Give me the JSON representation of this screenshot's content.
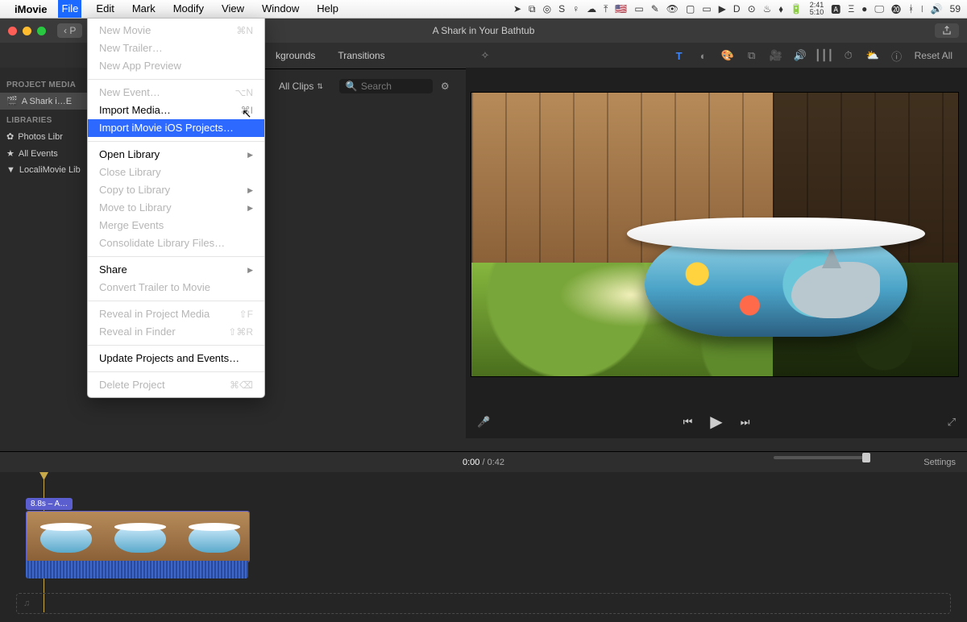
{
  "menubar": {
    "app_name": "iMovie",
    "items": [
      "File",
      "Edit",
      "Mark",
      "Modify",
      "View",
      "Window",
      "Help"
    ],
    "open_index": 0,
    "clock_time": "2:41",
    "clock_sub": "5:10",
    "right_extra": "59"
  },
  "titlebar": {
    "title": "A Shark in Your Bathtub",
    "back_glyph": "‹ P"
  },
  "toolbar2": {
    "left_tabs": [
      "kgrounds",
      "Transitions"
    ],
    "reset_all": "Reset All"
  },
  "filterbar": {
    "allclips": "All Clips",
    "search_placeholder": "Search"
  },
  "sidebar": {
    "section1": "PROJECT MEDIA",
    "project": "A Shark i…E",
    "section2": "LIBRARIES",
    "rows": [
      "Photos Libr",
      "All Events",
      "LocaliMovie Lib"
    ]
  },
  "dropdown": {
    "items": [
      {
        "label": "New Movie",
        "shortcut": "⌘N",
        "disabled": true
      },
      {
        "label": "New Trailer…",
        "shortcut": "",
        "disabled": true
      },
      {
        "label": "New App Preview",
        "shortcut": "",
        "disabled": true
      },
      {
        "sep": true
      },
      {
        "label": "New Event…",
        "shortcut": "⌥N",
        "disabled": true
      },
      {
        "label": "Import Media…",
        "shortcut": "⌘I",
        "disabled": false
      },
      {
        "label": "Import iMovie iOS Projects…",
        "shortcut": "",
        "disabled": false,
        "highlight": true
      },
      {
        "sep": true
      },
      {
        "label": "Open Library",
        "shortcut": "",
        "disabled": false,
        "submenu": true
      },
      {
        "label": "Close Library",
        "shortcut": "",
        "disabled": true
      },
      {
        "label": "Copy to Library",
        "shortcut": "",
        "disabled": true,
        "submenu": true
      },
      {
        "label": "Move to Library",
        "shortcut": "",
        "disabled": true,
        "submenu": true
      },
      {
        "label": "Merge Events",
        "shortcut": "",
        "disabled": true
      },
      {
        "label": "Consolidate Library Files…",
        "shortcut": "",
        "disabled": true
      },
      {
        "sep": true
      },
      {
        "label": "Share",
        "shortcut": "",
        "disabled": false,
        "submenu": true
      },
      {
        "label": "Convert Trailer to Movie",
        "shortcut": "",
        "disabled": true
      },
      {
        "sep": true
      },
      {
        "label": "Reveal in Project Media",
        "shortcut": "⇧F",
        "disabled": true
      },
      {
        "label": "Reveal in Finder",
        "shortcut": "⇧⌘R",
        "disabled": true
      },
      {
        "sep": true
      },
      {
        "label": "Update Projects and Events…",
        "shortcut": "",
        "disabled": false
      },
      {
        "sep": true
      },
      {
        "label": "Delete Project",
        "shortcut": "⌘⌫",
        "disabled": true
      }
    ]
  },
  "timeline": {
    "current": "0:00",
    "duration": "0:42",
    "settings": "Settings",
    "clip_label": "8.8s – A…",
    "music_glyph": "♫"
  }
}
